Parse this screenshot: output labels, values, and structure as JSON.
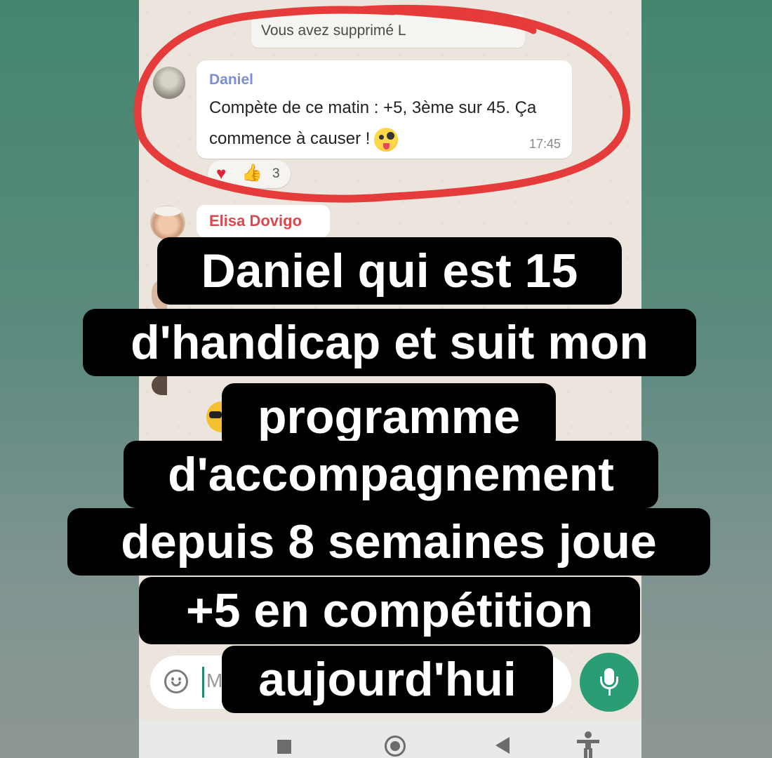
{
  "chat": {
    "system_message": "Vous avez supprimé L",
    "message": {
      "sender": "Daniel",
      "text": "Compète de ce matin : +5, 3ème sur 45. Ça commence à causer !",
      "time": "17:45",
      "reactions": {
        "heart_icon": "heart",
        "thumb_icon": "thumbs-up",
        "count": "3"
      }
    },
    "next_sender": "Elisa Dovigo"
  },
  "input": {
    "placeholder": "M"
  },
  "caption": {
    "lines": [
      "Daniel qui est 15",
      "d'handicap et suit mon",
      "programme",
      "d'accompagnement",
      "depuis 8 semaines joue",
      "+5 en compétition",
      "aujourd'hui"
    ]
  },
  "colors": {
    "background_top": "#43876f",
    "chat_background": "#ece5dd",
    "sender_daniel": "#7b8fd6",
    "sender_elisa": "#d9484f",
    "mic_button": "#2a9d74",
    "highlight_circle": "#e53b3b"
  },
  "icons": {
    "emoji": "smiley-face-icon",
    "mic": "microphone-icon",
    "nav": [
      "stop-square-icon",
      "home-circle-icon",
      "back-triangle-icon",
      "accessibility-icon"
    ]
  }
}
